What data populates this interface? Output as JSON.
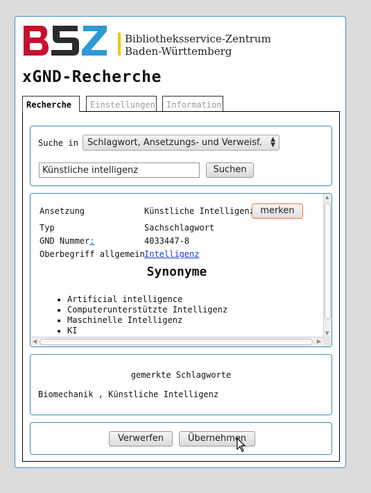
{
  "header": {
    "logo_text": "BSZ",
    "org_line1": "Bibliotheksservice-Zentrum",
    "org_line2": "Baden-Württemberg",
    "colors": {
      "b": "#c8102e",
      "s": "#2b2b2b",
      "z": "#2c9ad6",
      "bar": "#f4c600"
    },
    "app_title": "xGND-Recherche"
  },
  "tabs": [
    {
      "label": "Recherche",
      "active": true
    },
    {
      "label": "Einstellungen",
      "active": false
    },
    {
      "label": "Information",
      "active": false
    }
  ],
  "search": {
    "label": "Suche in",
    "scope_selected": "Schlagwort, Ansetzungs- und Verweisf.",
    "query": "Künstliche intelligenz",
    "button": "Suchen"
  },
  "result": {
    "fields": [
      {
        "key": "Ansetzung",
        "value": "Künstliche Intelligenz"
      },
      {
        "key": "Typ",
        "value": "Sachschlagwort"
      },
      {
        "key": "GND Nummer",
        "key_link": ":",
        "value": "4033447-8"
      },
      {
        "key": "Oberbegriff allgemein",
        "value": "Intelligenz"
      }
    ],
    "bookmark_button": "merken",
    "synonyms_title": "Synonyme",
    "synonyms": [
      "Artificial intelligence",
      "Computerunterstützte Intelligenz",
      "Maschinelle Intelligenz",
      "KI"
    ]
  },
  "marked": {
    "title": "gemerkte Schlagworte",
    "items_text": "Biomechanik , Künstliche Intelligenz"
  },
  "actions": {
    "discard": "Verwerfen",
    "apply": "Übernehmen"
  }
}
